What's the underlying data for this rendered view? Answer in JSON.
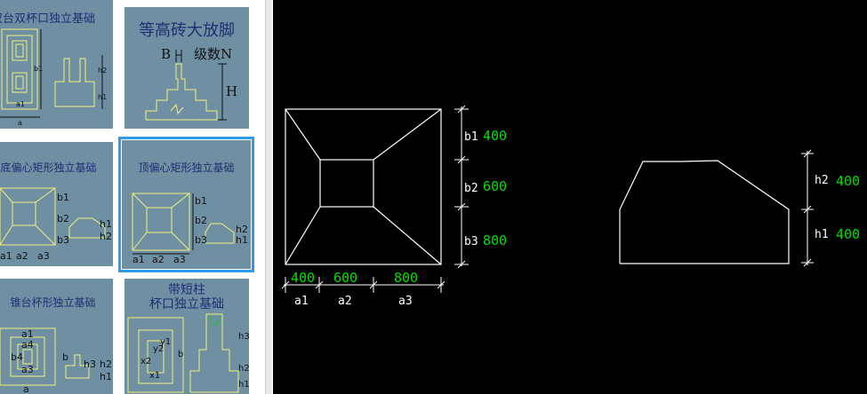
{
  "gallery": {
    "tiles": [
      {
        "title": "双台双杯口独立基础"
      },
      {
        "title": "等高砖大放脚",
        "labels": {
          "b": "B",
          "n": "级数N",
          "h": "H"
        }
      },
      {
        "title": "底偏心矩形独立基础"
      },
      {
        "title": "顶偏心矩形独立基础"
      },
      {
        "title": "锥台杯形独立基础"
      },
      {
        "title_line1": "带短柱",
        "title_line2": "杯口独立基础"
      }
    ],
    "dim_labels": {
      "a1": "a1",
      "a2": "a2",
      "a3": "a3",
      "b1": "b1",
      "b2": "b2",
      "b3": "b3",
      "h1": "h1",
      "h2": "h2",
      "h3": "h3",
      "a": "a",
      "b": "b"
    }
  },
  "canvas": {
    "plan": {
      "b1_label": "b1",
      "b1_value": "400",
      "b2_label": "b2",
      "b2_value": "600",
      "b3_label": "b3",
      "b3_value": "800",
      "a1_label": "a1",
      "a1_value": "400",
      "a2_label": "a2",
      "a2_value": "600",
      "a3_label": "a3",
      "a3_value": "800"
    },
    "section": {
      "h2_label": "h2",
      "h2_value": "400",
      "h1_label": "h1",
      "h1_value": "400"
    }
  },
  "colors": {
    "tile_bg": "#6f8fa3",
    "tile_line": "#f2f27a",
    "selected_border": "#2f9bef",
    "canvas_bg": "#000000",
    "cad_line": "#ffffff",
    "cad_value": "#00e000"
  }
}
